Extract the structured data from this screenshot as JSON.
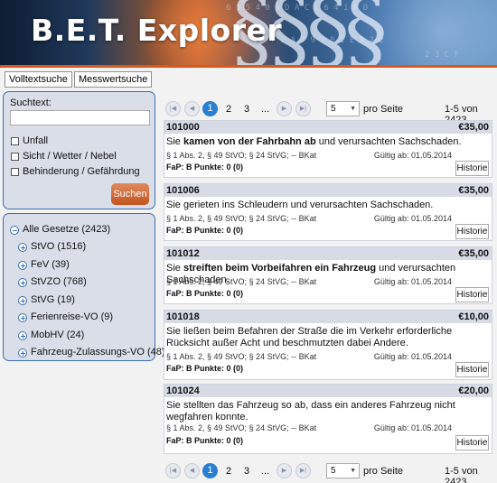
{
  "app": {
    "title": "B.E.T. Explorer"
  },
  "tabs": [
    {
      "label": "Volltextsuche"
    },
    {
      "label": "Messwertsuche"
    }
  ],
  "search": {
    "label": "Suchtext:",
    "value": "",
    "checkboxes": [
      {
        "label": "Unfall",
        "checked": false
      },
      {
        "label": "Sicht / Wetter / Nebel",
        "checked": false
      },
      {
        "label": "Behinderung / Gefährdung",
        "checked": false
      }
    ],
    "button": "Suchen"
  },
  "laws": {
    "root": "Alle Gesetze (2423)",
    "items": [
      {
        "label": "StVO (1516)"
      },
      {
        "label": "FeV (39)"
      },
      {
        "label": "StVZO (768)"
      },
      {
        "label": "StVG (19)"
      },
      {
        "label": "Ferienreise-VO (9)"
      },
      {
        "label": "MobHV (24)"
      },
      {
        "label": "Fahrzeug-Zulassungs-VO (48)"
      }
    ]
  },
  "pager": {
    "pages": [
      "1",
      "2",
      "3"
    ],
    "ellipsis": "...",
    "per_page": "5",
    "per_page_label": "pro Seite",
    "range": "1-5 von 2423",
    "current": "1"
  },
  "entries": [
    {
      "id": "101000",
      "price": "€35,00",
      "desc_parts": [
        "Sie ",
        "kamen von der Fahrbahn ab",
        " und verursachten Sachschaden."
      ],
      "law": "§ 1 Abs. 2, § 49 StVO; § 24 StVG; -- BKat",
      "valid": "Gültig ab: 01.05.2014",
      "fap": "FaP: B Punkte: 0 (0)",
      "history": "Historie"
    },
    {
      "id": "101006",
      "price": "€35,00",
      "desc_parts": [
        "Sie gerieten ins Schleudern und verursachten Sachschaden.",
        "",
        ""
      ],
      "law": "§ 1 Abs. 2, § 49 StVO; § 24 StVG; -- BKat",
      "valid": "Gültig ab: 01.05.2014",
      "fap": "FaP: B Punkte: 0 (0)",
      "history": "Historie"
    },
    {
      "id": "101012",
      "price": "€35,00",
      "desc_parts": [
        "Sie ",
        "streiften beim Vorbeifahren ein Fahrzeug",
        " und verursachten Sachschaden."
      ],
      "law": "§ 1 Abs. 2, § 49 StVO; § 24 StVG; -- BKat",
      "valid": "Gültig ab: 01.05.2014",
      "fap": "FaP: B Punkte: 0 (0)",
      "history": "Historie"
    },
    {
      "id": "101018",
      "price": "€10,00",
      "desc_parts": [
        "Sie ließen beim Befahren der Straße die im Verkehr erforderliche Rücksicht außer Acht und beschmutzten dabei Andere.",
        "",
        ""
      ],
      "law": "§ 1 Abs. 2, § 49 StVO; § 24 StVG; -- BKat",
      "valid": "Gültig ab: 01.05.2014",
      "fap": "FaP: B Punkte: 0 (0)",
      "history": "Historie"
    },
    {
      "id": "101024",
      "price": "€20,00",
      "desc_parts": [
        "Sie stellten das Fahrzeug so ab, dass ein anderes Fahrzeug nicht wegfahren konnte.",
        "",
        ""
      ],
      "law": "§ 1 Abs. 2, § 49 StVO; § 24 StVG; -- BKat",
      "valid": "Gültig ab: 01.05.2014",
      "fap": "FaP: B Punkte: 0 (0)",
      "history": "Historie"
    }
  ]
}
